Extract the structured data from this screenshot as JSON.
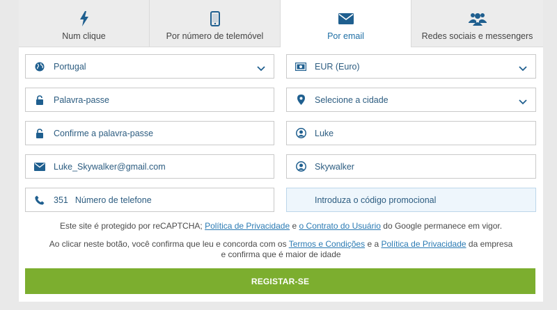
{
  "tabs": [
    {
      "label": "Num clique",
      "icon": "lightning-icon"
    },
    {
      "label": "Por número de telemóvel",
      "icon": "mobile-phone-icon"
    },
    {
      "label": "Por email",
      "icon": "envelope-icon",
      "active": true
    },
    {
      "label": "Redes sociais e messengers",
      "icon": "users-group-icon"
    }
  ],
  "form": {
    "country": {
      "value": "Portugal",
      "icon": "globe-icon"
    },
    "currency": {
      "value": "EUR (Euro)",
      "icon": "banknote-icon"
    },
    "password": {
      "placeholder": "Palavra-passe",
      "icon": "lock-icon"
    },
    "city": {
      "placeholder": "Selecione a cidade",
      "icon": "map-pin-icon"
    },
    "confirm_password": {
      "placeholder": "Confirme a palavra-passe",
      "icon": "lock-icon"
    },
    "first_name": {
      "value": "Luke",
      "icon": "user-circle-icon"
    },
    "email": {
      "value": "Luke_Skywalker@gmail.com",
      "icon": "envelope-icon"
    },
    "last_name": {
      "value": "Skywalker",
      "icon": "user-circle-icon"
    },
    "phone": {
      "code": "351",
      "placeholder": "Número de telefone",
      "icon": "phone-icon"
    },
    "promo": {
      "placeholder": "Introduza o código promocional"
    }
  },
  "recaptcha_note": {
    "prefix": "Este site é protegido por reCAPTCHA;",
    "privacy_link": "Política de Privacidade",
    "middle": "e",
    "terms_link": "o Contrato do Usuário",
    "suffix": "do Google permanece em vigor."
  },
  "consent_note": {
    "prefix": "Ao clicar neste botão, você confirma que leu e concorda com os",
    "terms_link": "Termos e Condições",
    "middle": "e a",
    "privacy_link": "Política de Privacidade",
    "suffix": "da empresa e confirma que é maior de idade"
  },
  "submit_label": "REGISTAR-SE",
  "colors": {
    "accent": "#2a7ab3",
    "button": "#7cae2f",
    "icon": "#1f5f8f"
  }
}
